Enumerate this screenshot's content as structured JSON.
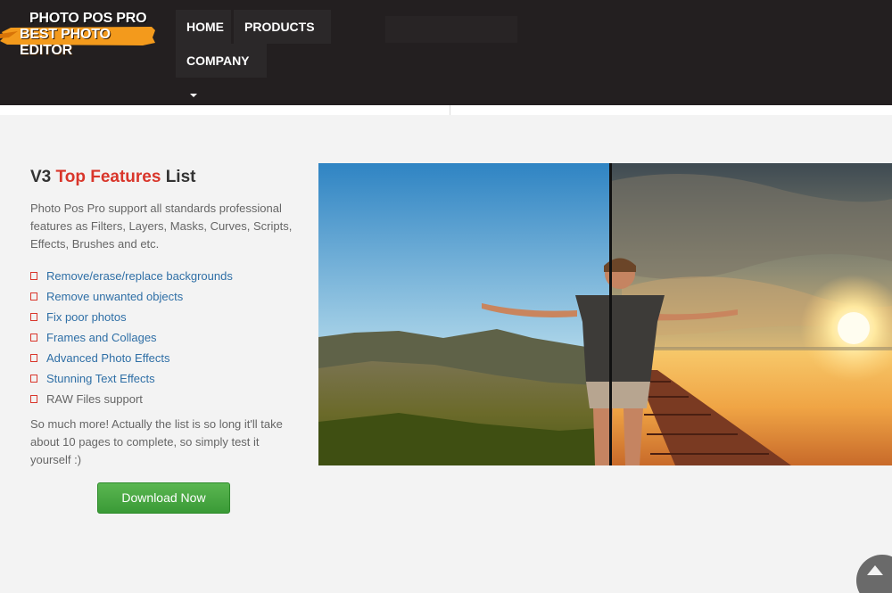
{
  "logo": {
    "line1": "PHOTO POS PRO",
    "line2": "BEST PHOTO EDITOR"
  },
  "nav": {
    "home": "HOME",
    "products": "PRODUCTS",
    "company": "COMPANY"
  },
  "features_section": {
    "heading_prefix": "V3 ",
    "heading_accent": "Top Features",
    "heading_suffix": " List",
    "intro": "Photo Pos Pro support all standards professional features as Filters, Layers, Masks, Curves, Scripts, Effects, Brushes and etc.",
    "items": [
      "Remove/erase/replace backgrounds",
      "Remove unwanted objects",
      "Fix poor photos",
      "Frames and Collages",
      "Advanced Photo Effects",
      "Stunning Text Effects",
      "RAW Files support"
    ],
    "outro": "So much more! Actually the list is so long it'll take about 10 pages to complete, so simply test it yourself :)",
    "download_label": "Download Now"
  },
  "icons": {
    "bullet": "square-bullet-icon",
    "caret": "caret-down-icon",
    "back_to_top": "arrow-up-icon"
  },
  "colors": {
    "header_bg": "#231f20",
    "accent": "#d9362b",
    "link": "#2f6fa6",
    "download_button": "#43a73e",
    "logo_orange": "#f39a1c"
  }
}
